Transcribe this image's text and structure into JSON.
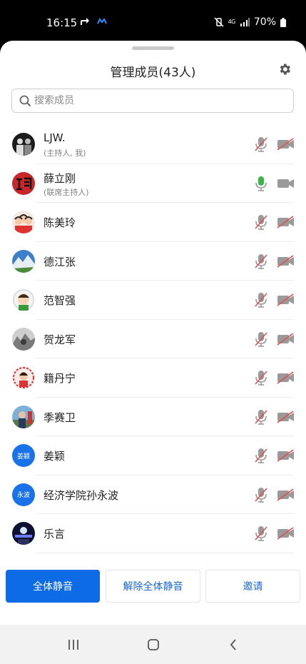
{
  "status_bar": {
    "time": "16:15",
    "network": "4G",
    "battery": "70%"
  },
  "header": {
    "title": "管理成员(43人)"
  },
  "search": {
    "placeholder": "搜索成员"
  },
  "members": [
    {
      "name": "LJW.",
      "role": "(主持人, 我)",
      "mic": "muted",
      "camera": "off",
      "avatar": "photo-dark"
    },
    {
      "name": "薛立刚",
      "role": "(联席主持人)",
      "mic": "on",
      "camera": "on",
      "avatar": "photo-red"
    },
    {
      "name": "陈美玲",
      "role": "",
      "mic": "muted",
      "camera": "off",
      "avatar": "photo-cartoon"
    },
    {
      "name": "德江张",
      "role": "",
      "mic": "muted",
      "camera": "off",
      "avatar": "photo-mountain"
    },
    {
      "name": "范智强",
      "role": "",
      "mic": "muted",
      "camera": "off",
      "avatar": "photo-kid"
    },
    {
      "name": "贺龙军",
      "role": "",
      "mic": "muted",
      "camera": "off",
      "avatar": "photo-gray"
    },
    {
      "name": "籍丹宁",
      "role": "",
      "mic": "muted",
      "camera": "off",
      "avatar": "photo-festive"
    },
    {
      "name": "季赛卫",
      "role": "",
      "mic": "muted",
      "camera": "off",
      "avatar": "photo-outdoor"
    },
    {
      "name": "姜颖",
      "role": "",
      "mic": "muted",
      "camera": "off",
      "avatar_text": "姜颖"
    },
    {
      "name": "经济学院孙永波",
      "role": "",
      "mic": "muted",
      "camera": "off",
      "avatar_text": "永波"
    },
    {
      "name": "乐言",
      "role": "",
      "mic": "muted",
      "camera": "off",
      "avatar": "photo-night"
    }
  ],
  "buttons": {
    "mute_all": "全体静音",
    "unmute_all": "解除全体静音",
    "invite": "邀请"
  },
  "colors": {
    "accent": "#0e6be6",
    "mic_on": "#3bb54a",
    "muted_slash": "#e05050",
    "icon_gray": "#9a9a9a"
  }
}
